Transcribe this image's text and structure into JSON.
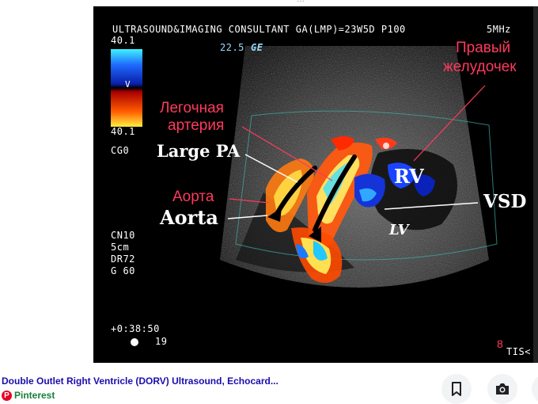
{
  "top_fragment": "…",
  "ultrasound": {
    "header": "ULTRASOUND&IMAGING CONSULTANT GA(LMP)=23W5D P100",
    "freq": "5MHz",
    "gain": "22.5",
    "gain_suffix": "GE",
    "scale_top": "40.1",
    "scale_mid": "V",
    "scale_bottom": "40.1",
    "cg": "CG0",
    "params": [
      "CN10",
      "5cm",
      "DR72",
      "G 60"
    ],
    "time": "+0:38:50",
    "frame": "19",
    "page_num": "8",
    "tis": "TIS<",
    "labels": {
      "large_pa": "Large PA",
      "aorta": "Aorta",
      "rv": "RV",
      "lv": "LV",
      "vsd": "VSD"
    },
    "ru_labels": {
      "pulm_line1": "Легочная",
      "pulm_line2": "артерия",
      "aorta": "Аорта",
      "rv_line1": "Правый",
      "rv_line2": "желудочек"
    }
  },
  "result": {
    "title": "Double Outlet Right Ventricle (DORV) Ultrasound, Echocard...",
    "source": "Pinterest",
    "icons": [
      "pinterest-icon",
      "bookmark-icon",
      "camera-search-icon"
    ]
  }
}
